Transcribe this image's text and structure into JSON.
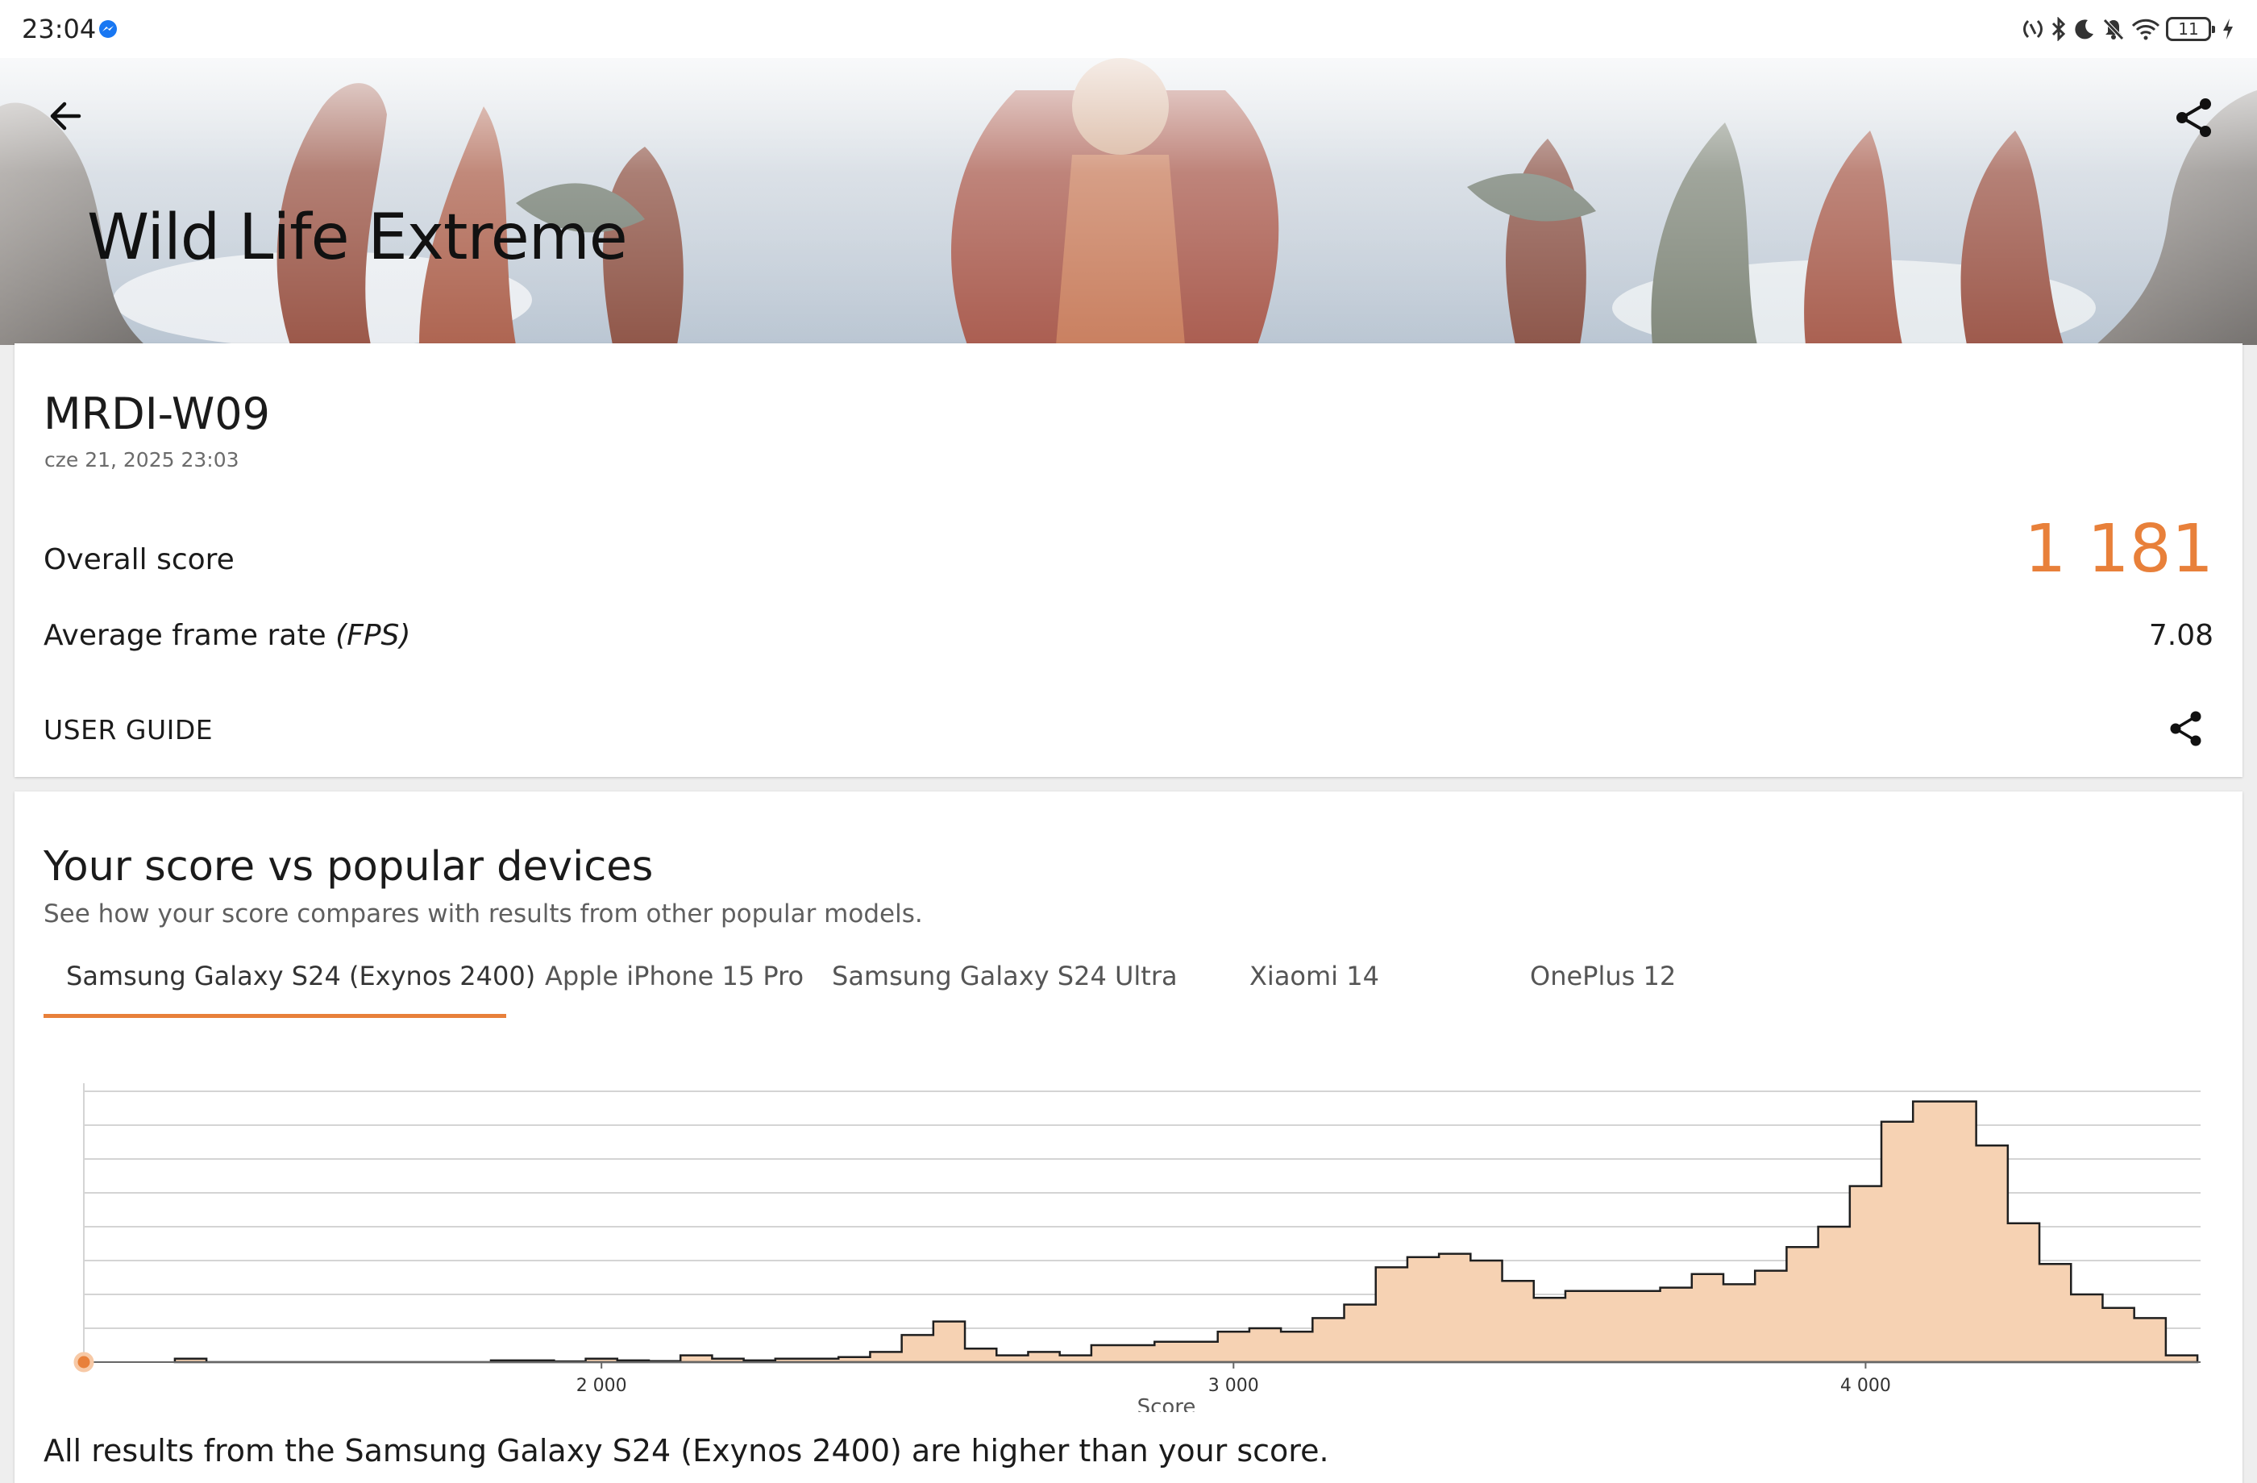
{
  "status_bar": {
    "time": "23:04",
    "icons": [
      "messenger-icon",
      "nfc-icon",
      "bluetooth-icon",
      "moon-icon",
      "mute-icon",
      "wifi-icon",
      "battery-icon",
      "charging-icon"
    ],
    "battery": "11"
  },
  "header": {
    "title": "Wild Life Extreme",
    "back_icon": "arrow-left-icon",
    "share_icon": "share-icon"
  },
  "result": {
    "device": "MRDI-W09",
    "date": "cze 21, 2025 23:03",
    "overall_label": "Overall score",
    "overall_value": "1 181",
    "fps_label": "Average frame rate",
    "fps_unit": "(FPS)",
    "fps_value": "7.08",
    "user_guide": "USER GUIDE",
    "accent_color": "#e8803a"
  },
  "comparison": {
    "title": "Your score vs popular devices",
    "subtitle": "See how your score compares with results from other popular models.",
    "tabs": [
      {
        "label": "Samsung Galaxy S24 (Exynos 2400)",
        "active": true
      },
      {
        "label": "Apple iPhone 15 Pro",
        "active": false
      },
      {
        "label": "Samsung Galaxy S24 Ultra",
        "active": false
      },
      {
        "label": "Xiaomi 14",
        "active": false
      },
      {
        "label": "OnePlus 12",
        "active": false
      }
    ],
    "footer": "All results from the Samsung Galaxy S24 (Exynos 2400) are higher than your score."
  },
  "chart_data": {
    "type": "area",
    "xlabel": "Score",
    "ylabel": "",
    "x_ticks": [
      {
        "value": 2000,
        "label": "2 000"
      },
      {
        "value": 3000,
        "label": "3 000"
      },
      {
        "value": 4000,
        "label": "4 000"
      }
    ],
    "xlim": [
      1181,
      4530
    ],
    "ylim": [
      0,
      8
    ],
    "grid": true,
    "bin_width": 50,
    "bins_start": 1325,
    "counts": [
      0.1,
      0,
      0,
      0,
      0,
      0,
      0,
      0,
      0,
      0,
      0.05,
      0.05,
      0.02,
      0.1,
      0.05,
      0.03,
      0.2,
      0.1,
      0.05,
      0.1,
      0.1,
      0.15,
      0.3,
      0.8,
      1.2,
      0.4,
      0.2,
      0.3,
      0.2,
      0.5,
      0.5,
      0.6,
      0.6,
      0.9,
      1.0,
      0.9,
      1.3,
      1.7,
      2.8,
      3.1,
      3.2,
      3.0,
      2.4,
      1.9,
      2.1,
      2.1,
      2.1,
      2.2,
      2.6,
      2.3,
      2.7,
      3.4,
      4.0,
      5.2,
      7.1,
      7.7,
      7.7,
      6.4,
      4.1,
      2.9,
      2.0,
      1.6,
      1.3,
      0.2
    ],
    "your_score": 1181,
    "fill_color": "#f6d2b3",
    "stroke_color": "#1f1f1f",
    "marker_color": "#e8803a"
  }
}
